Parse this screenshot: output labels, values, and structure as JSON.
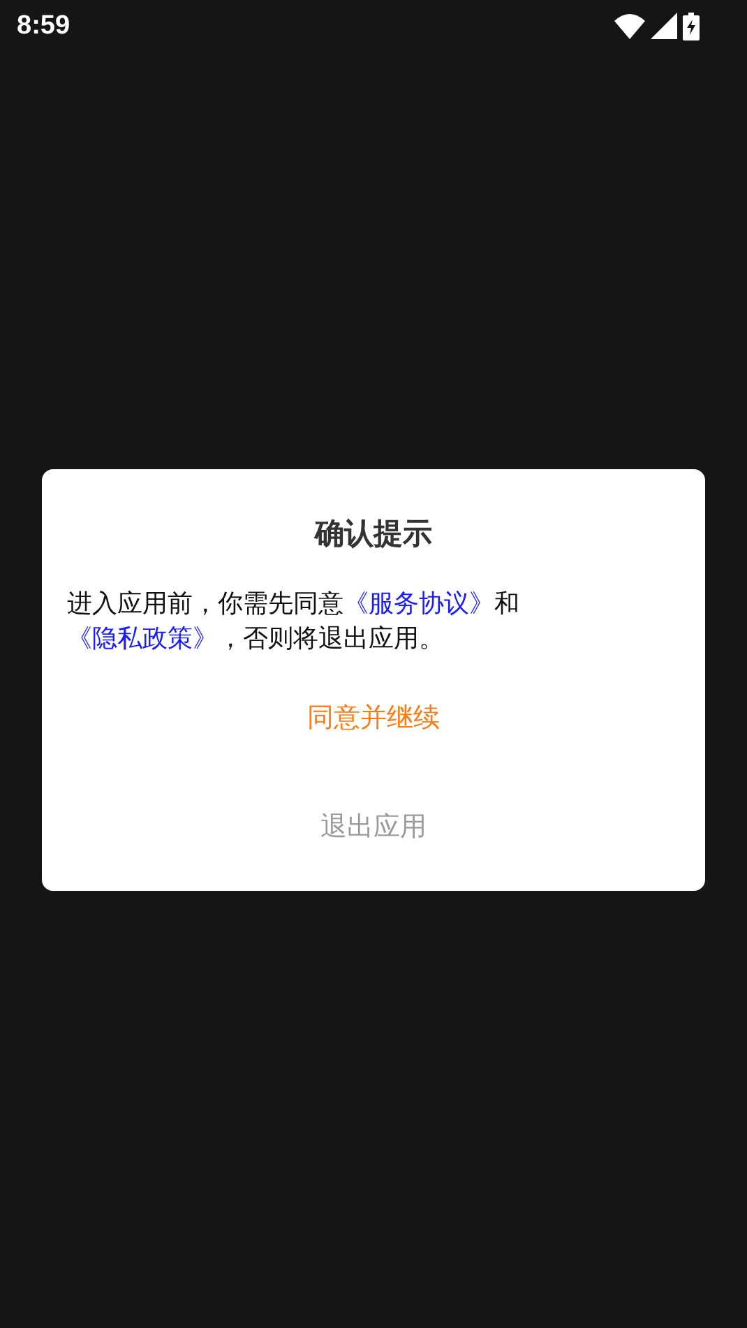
{
  "status_bar": {
    "time": "8:59"
  },
  "dialog": {
    "title": "确认提示",
    "message": [
      {
        "kind": "text",
        "text": "进入应用前，你需先同意"
      },
      {
        "kind": "link",
        "text": "《服务协议》"
      },
      {
        "kind": "text",
        "text": "和"
      },
      {
        "kind": "link",
        "text": "《隐私政策》"
      },
      {
        "kind": "text",
        "text": "，否则将退出应用。"
      }
    ],
    "buttons": [
      {
        "kind": "primary",
        "label": "同意并继续"
      },
      {
        "kind": "secondary",
        "label": "退出应用"
      }
    ]
  }
}
